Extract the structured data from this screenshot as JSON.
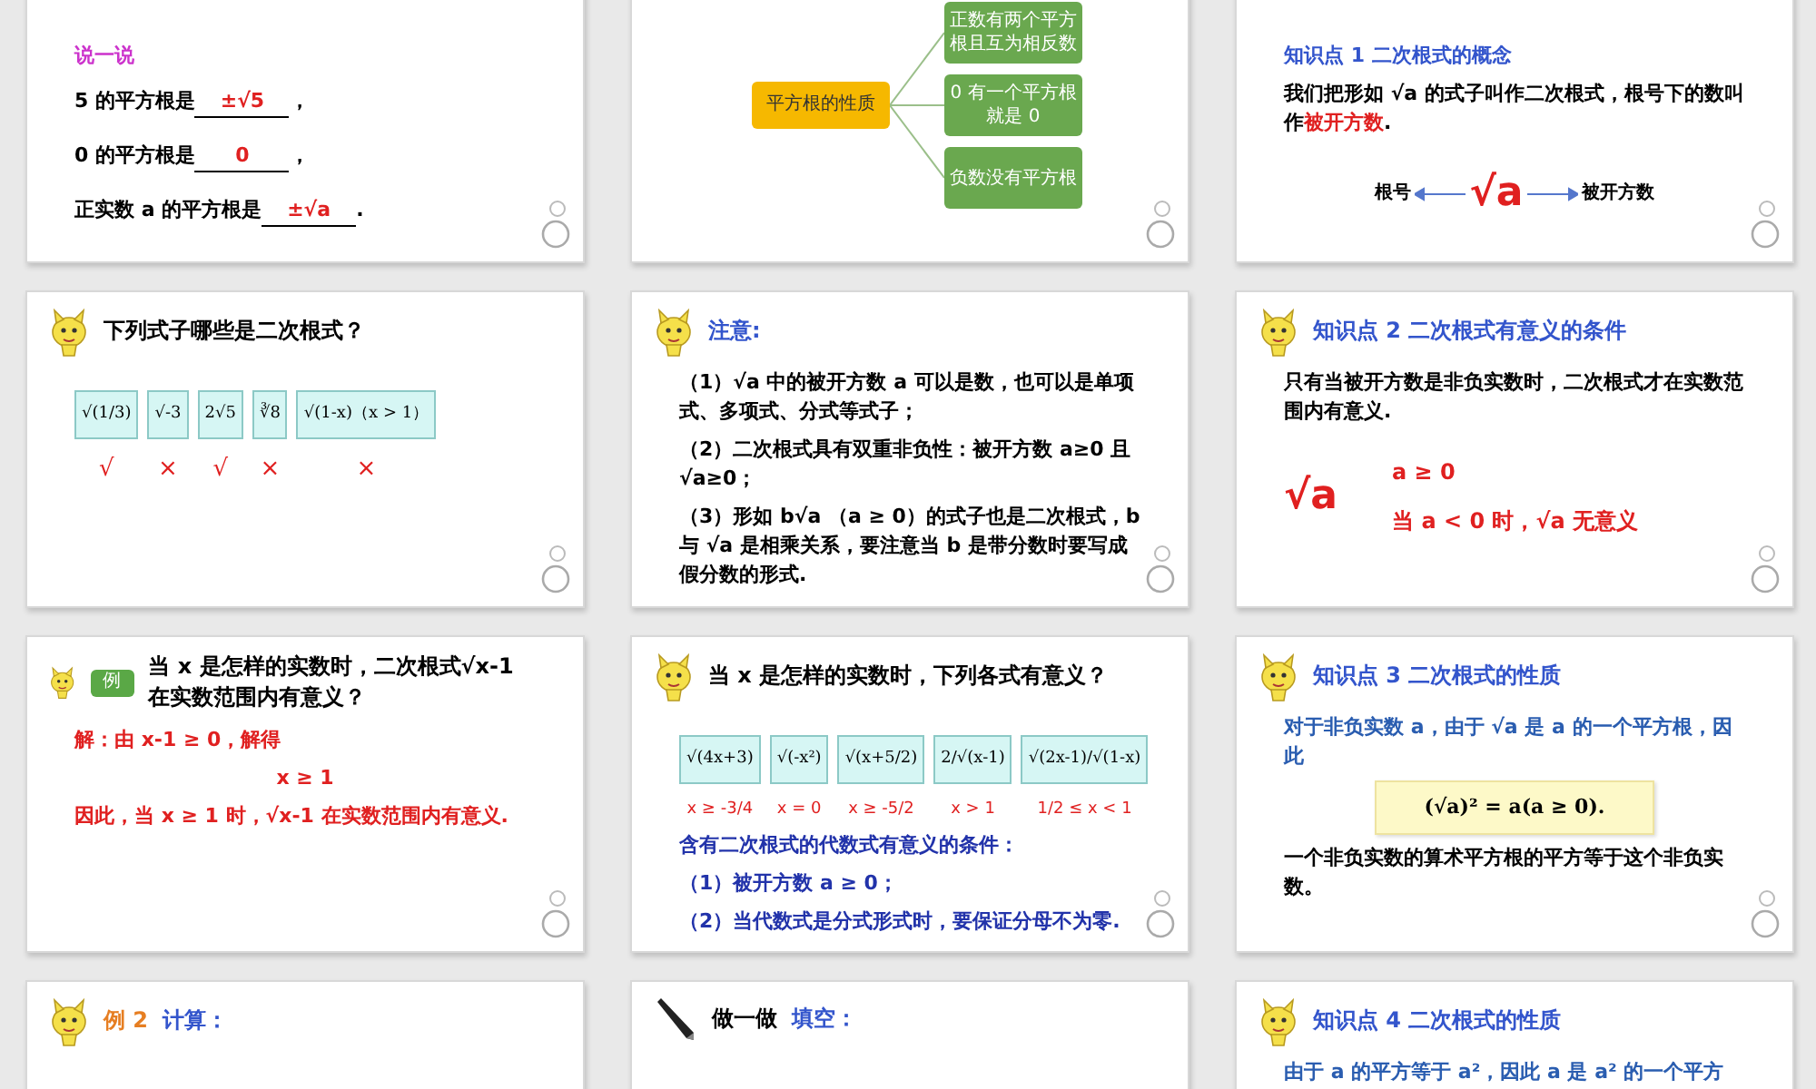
{
  "slides": [
    {
      "blocks": [
        {
          "kind": "text",
          "text": "说一说",
          "color": "#cc33cc"
        },
        {
          "kind": "fill",
          "before": "5 的平方根是",
          "answer": "±√5",
          "after": "，"
        },
        {
          "kind": "fill",
          "before": "0 的平方根是",
          "answer": "0",
          "after": "，"
        },
        {
          "kind": "fill",
          "before": "正实数 a 的平方根是",
          "answer": "±√a",
          "after": "."
        }
      ]
    },
    {
      "blocks": [
        {
          "kind": "mindmap",
          "center": "平方根的性质",
          "branches": [
            "正数有两个平方根且互为相反数",
            "0 有一个平方根就是 0",
            "负数没有平方根"
          ]
        }
      ]
    },
    {
      "blocks": [
        {
          "kind": "text",
          "text": "知识点 1  二次根式的概念",
          "color": "#3355cc"
        },
        {
          "kind": "rich-text",
          "parts": [
            {
              "text": "我们把形如 √a 的式子叫作二次根式，根号下的数叫作",
              "emphasis": false
            },
            {
              "text": "被开方数",
              "emphasis": true
            },
            {
              "text": ".",
              "emphasis": false
            }
          ]
        },
        {
          "kind": "root-diagram",
          "left": "根号",
          "symbol": "√a",
          "right": "被开方数"
        }
      ]
    },
    {
      "heading": [
        {
          "kind": "text",
          "text": "下列式子哪些是二次根式？",
          "color": "#000000"
        }
      ],
      "blocks": [
        {
          "kind": "choices",
          "items": [
            {
              "expr": "√(1/3)",
              "result": "√"
            },
            {
              "expr": "√-3",
              "result": "×"
            },
            {
              "expr": "2√5",
              "result": "√"
            },
            {
              "expr": "∛8",
              "result": "×"
            },
            {
              "expr": "√(1-x)（x > 1）",
              "result": "×"
            }
          ]
        }
      ]
    },
    {
      "heading": [
        {
          "kind": "text",
          "text": "注意:",
          "color": "#3355cc"
        }
      ],
      "blocks": [
        {
          "kind": "text",
          "text": "（1）√a 中的被开方数 a 可以是数，也可以是单项式、多项式、分式等式子；",
          "color": "#000000"
        },
        {
          "kind": "text",
          "text": "（2）二次根式具有双重非负性：被开方数 a≥0 且 √a≥0；",
          "color": "#000000"
        },
        {
          "kind": "text",
          "text": "（3）形如 b√a （a ≥ 0）的式子也是二次根式，b 与 √a 是相乘关系，要注意当 b 是带分数时要写成假分数的形式.",
          "color": "#000000"
        }
      ]
    },
    {
      "heading": [
        {
          "kind": "text",
          "text": "知识点 2  二次根式有意义的条件",
          "color": "#3355cc"
        }
      ],
      "blocks": [
        {
          "kind": "text",
          "text": "只有当被开方数是非负实数时，二次根式才在实数范围内有意义.",
          "color": "#000000"
        },
        {
          "kind": "condition",
          "symbol": "√a",
          "lines": [
            "a ≥ 0",
            "当 a < 0 时，√a  无意义"
          ]
        }
      ]
    },
    {
      "heading": [
        {
          "kind": "badge",
          "text": "例",
          "color": "#5aa846"
        },
        {
          "kind": "text",
          "text": "当 x 是怎样的实数时，二次根式√x-1 在实数范围内有意义？",
          "color": "#000000"
        }
      ],
      "blocks": [
        {
          "kind": "text",
          "text": "解：由 x-1 ≥ 0，解得",
          "color": "#e02020"
        },
        {
          "kind": "text-center",
          "text": "x ≥ 1",
          "color": "#e02020"
        },
        {
          "kind": "text",
          "text": "因此，当 x ≥ 1 时，√x-1 在实数范围内有意义.",
          "color": "#e02020"
        }
      ]
    },
    {
      "heading": [
        {
          "kind": "text",
          "text": "当 x 是怎样的实数时，下列各式有意义？",
          "color": "#000000"
        }
      ],
      "blocks": [
        {
          "kind": "choices",
          "items": [
            {
              "expr": "√(4x+3)",
              "result": "x ≥ -3/4"
            },
            {
              "expr": "√(-x²)",
              "result": "x = 0"
            },
            {
              "expr": "√(x+5/2)",
              "result": "x ≥ -5/2"
            },
            {
              "expr": "2/√(x-1)",
              "result": "x > 1"
            },
            {
              "expr": "√(2x-1)/√(1-x)",
              "result": "1/2 ≤ x < 1"
            }
          ]
        },
        {
          "kind": "text",
          "text": "含有二次根式的代数式有意义的条件：",
          "color": "#2233aa"
        },
        {
          "kind": "text",
          "text": "（1）被开方数 a ≥ 0；",
          "color": "#2233aa"
        },
        {
          "kind": "text",
          "text": "（2）当代数式是分式形式时，要保证分母不为零.",
          "color": "#2233aa"
        }
      ]
    },
    {
      "heading": [
        {
          "kind": "text",
          "text": "知识点 3  二次根式的性质",
          "color": "#3355cc"
        }
      ],
      "blocks": [
        {
          "kind": "text",
          "text": "对于非负实数 a，由于 √a 是 a 的一个平方根，因此",
          "color": "#2a5db0"
        },
        {
          "kind": "formula-box",
          "text": "(√a)² = a(a ≥ 0)."
        },
        {
          "kind": "text",
          "text": "一个非负实数的算术平方根的平方等于这个非负实数。",
          "color": "#000000"
        }
      ]
    },
    {
      "heading": [
        {
          "kind": "text",
          "text": "例 2",
          "color": "#e67e22"
        },
        {
          "kind": "text",
          "text": "计算：",
          "color": "#3355cc"
        }
      ]
    },
    {
      "heading": [
        {
          "kind": "text",
          "text": "做一做",
          "color": "#000000"
        },
        {
          "kind": "text",
          "text": "填空：",
          "color": "#3355cc"
        }
      ]
    },
    {
      "heading": [
        {
          "kind": "text",
          "text": "知识点 4  二次根式的性质",
          "color": "#3355cc"
        }
      ],
      "blocks": [
        {
          "kind": "text",
          "text": "由于 a 的平方等于 a²，因此 a 是 a² 的一个平方",
          "color": "#2a5db0"
        }
      ]
    }
  ]
}
